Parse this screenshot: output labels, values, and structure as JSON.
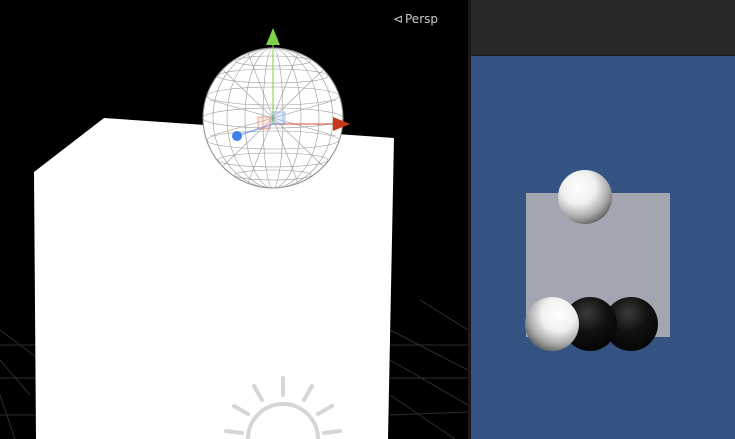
{
  "scene_view": {
    "camera_mode_label": "Persp",
    "camera_mode_icon": "persp-camera-icon",
    "gizmo_axes": {
      "y_color": "#7fd24a",
      "x_color": "#d8402a",
      "z_color": "#3a82e8"
    },
    "background_color": "#000000",
    "cube_color": "#ffffff",
    "sphere_wireframe_color": "#888888",
    "sun_icon": "directional-light-icon"
  },
  "game_view": {
    "background_color": "#355382",
    "toolbar_color": "#282828",
    "plane_color": "#a3a6b0",
    "spheres": [
      {
        "name": "white-sphere-top",
        "color": "white"
      },
      {
        "name": "white-sphere-bottom",
        "color": "white"
      },
      {
        "name": "black-sphere-middle",
        "color": "black"
      },
      {
        "name": "black-sphere-right",
        "color": "black"
      }
    ]
  }
}
